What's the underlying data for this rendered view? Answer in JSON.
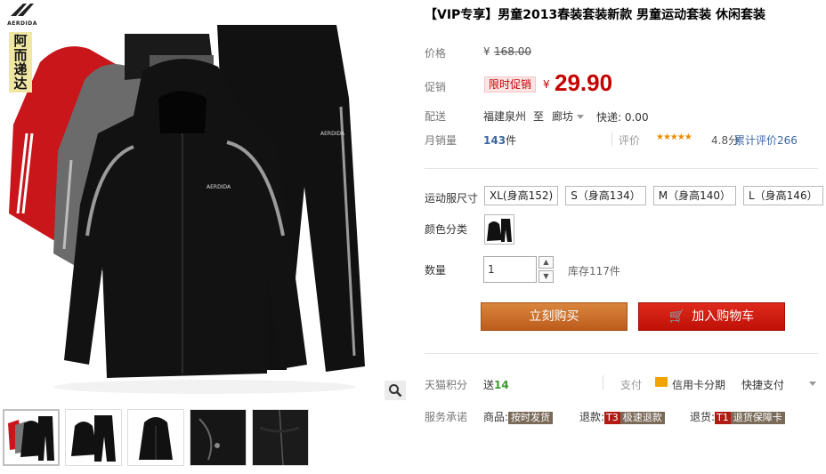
{
  "brand": {
    "logo_text": "AERDIDA",
    "cn_name": "阿而递达"
  },
  "gallery": {
    "zoom_icon": "magnifier-icon"
  },
  "product": {
    "title": "【VIP专享】男童2013春装套装新款 男童运动套装 休闲套装"
  },
  "price": {
    "label": "价格",
    "currency": "¥",
    "original": "168.00",
    "promo_label": "促销",
    "promo_tag": "限时促销",
    "current": "29.90"
  },
  "shipping": {
    "label": "配送",
    "from": "福建泉州",
    "to_word": "至",
    "to": "廊坊",
    "express": "快递: 0.00"
  },
  "sales": {
    "label": "月销量",
    "count": "143",
    "unit": "件",
    "rating_label": "评价",
    "stars": "★★★★★",
    "score": "4.8分",
    "reviews": "累计评价266"
  },
  "options": {
    "size_label": "运动服尺寸",
    "sizes": [
      "XL(身高152)",
      "S（身高134）",
      "M（身高140）",
      "L（身高146）"
    ],
    "color_label": "颜色分类"
  },
  "quantity": {
    "label": "数量",
    "value": "1",
    "stock": "库存117件",
    "up": "▲",
    "down": "▼"
  },
  "actions": {
    "buy_now": "立刻购买",
    "add_cart": "加入购物车",
    "cart_icon": "🛒"
  },
  "points": {
    "label": "天猫积分",
    "prefix": "送",
    "value": "14",
    "pay_label": "支付",
    "credit": "信用卡分期",
    "quick": "快捷支付"
  },
  "service": {
    "label": "服务承诺",
    "goods_label": "商品:",
    "goods_tag": "按时发货",
    "refund_label": "退款:",
    "refund_code": "T3",
    "refund_tag": "极速退款",
    "return_label": "退货:",
    "return_code": "T1",
    "return_tag": "退货保障卡"
  },
  "colors": {
    "accent_red": "#c40000",
    "buy_orange": "#c96a2a",
    "cart_red": "#d01c10",
    "link_blue": "#3a66a3"
  }
}
